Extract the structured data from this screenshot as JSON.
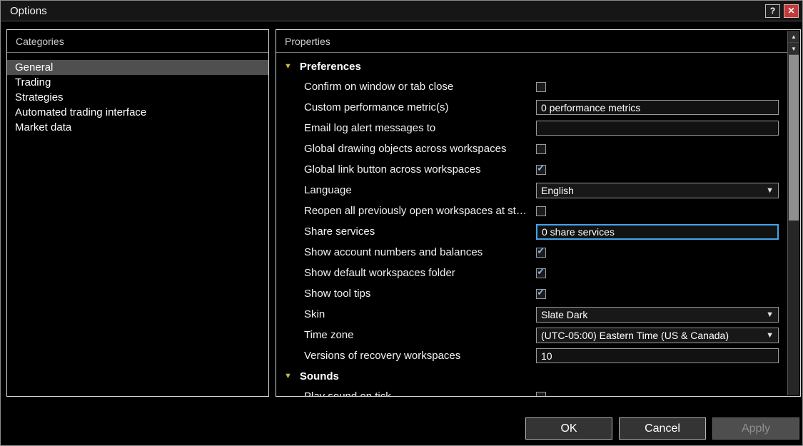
{
  "window": {
    "title": "Options"
  },
  "icons": {
    "help": "?",
    "close": "✕",
    "arrow_up": "▲",
    "arrow_down": "▼",
    "section_expanded": "▼",
    "dropdown": "▼",
    "check": "✓"
  },
  "colors": {
    "accent": "#42a5e8",
    "close_red": "#c23b3b",
    "check": "#7fb4e8",
    "triangle": "#c9b544",
    "selected_row": "#4f4f4f"
  },
  "categories": {
    "header": "Categories",
    "items": [
      {
        "label": "General",
        "selected": true
      },
      {
        "label": "Trading",
        "selected": false
      },
      {
        "label": "Strategies",
        "selected": false
      },
      {
        "label": "Automated trading interface",
        "selected": false
      },
      {
        "label": "Market data",
        "selected": false
      }
    ]
  },
  "properties": {
    "header": "Properties",
    "sections": [
      {
        "title": "Preferences",
        "rows": [
          {
            "label": "Confirm on window or tab close",
            "control": "checkbox",
            "checked": false
          },
          {
            "label": "Custom performance metric(s)",
            "control": "text",
            "value": "0 performance metrics"
          },
          {
            "label": "Email log alert messages to",
            "control": "text",
            "value": ""
          },
          {
            "label": "Global drawing objects across workspaces",
            "control": "checkbox",
            "checked": false
          },
          {
            "label": "Global link button across workspaces",
            "control": "checkbox",
            "checked": true
          },
          {
            "label": "Language",
            "control": "select",
            "value": "English"
          },
          {
            "label": "Reopen all previously open workspaces at st…",
            "control": "checkbox",
            "checked": false
          },
          {
            "label": "Share services",
            "control": "text",
            "value": "0 share services",
            "focused": true
          },
          {
            "label": "Show account numbers and balances",
            "control": "checkbox",
            "checked": true
          },
          {
            "label": "Show default workspaces folder",
            "control": "checkbox",
            "checked": true
          },
          {
            "label": "Show tool tips",
            "control": "checkbox",
            "checked": true
          },
          {
            "label": "Skin",
            "control": "select",
            "value": "Slate Dark"
          },
          {
            "label": "Time zone",
            "control": "select",
            "value": "(UTC-05:00) Eastern Time (US & Canada)"
          },
          {
            "label": "Versions of recovery workspaces",
            "control": "text",
            "value": "10"
          }
        ]
      },
      {
        "title": "Sounds",
        "rows": [
          {
            "label": "Play sound on tick",
            "control": "checkbox",
            "checked": false
          }
        ]
      }
    ]
  },
  "footer": {
    "ok": "OK",
    "cancel": "Cancel",
    "apply": "Apply"
  }
}
